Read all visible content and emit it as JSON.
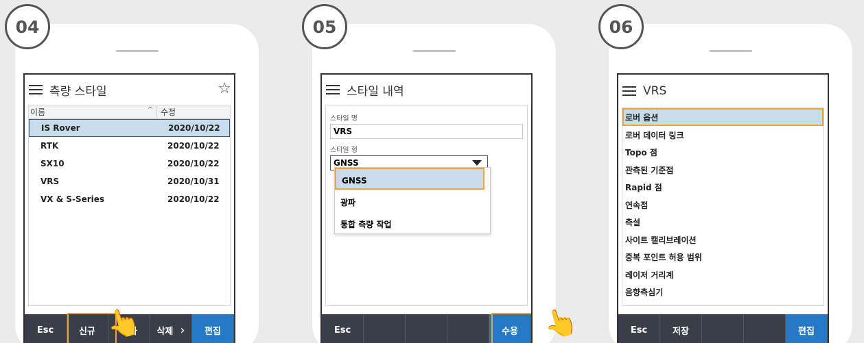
{
  "panels": [
    {
      "step": "04",
      "title": "측량 스타일",
      "columns": {
        "name": "이름",
        "sort": "^",
        "modified": "수정"
      },
      "rows": [
        {
          "name": "IS Rover",
          "date": "2020/10/22"
        },
        {
          "name": "RTK",
          "date": "2020/10/22"
        },
        {
          "name": "SX10",
          "date": "2020/10/22"
        },
        {
          "name": "VRS",
          "date": "2020/10/31"
        },
        {
          "name": "VX & S-Series",
          "date": "2020/10/22"
        }
      ],
      "buttons": [
        "Esc",
        "신규",
        "복사",
        "삭제",
        "편집"
      ],
      "more": "›"
    },
    {
      "step": "05",
      "title": "스타일 내역",
      "style_name_label": "스타일 명",
      "style_name_value": "VRS",
      "style_type_label": "스타일 형",
      "style_type_value": "GNSS",
      "options": [
        "GNSS",
        "광파",
        "통합 측량 작업"
      ],
      "buttons": [
        "Esc",
        "",
        "",
        "",
        "수용"
      ]
    },
    {
      "step": "06",
      "title": "VRS",
      "items": [
        "로버 옵션",
        "로버 데이터 링크",
        "Topo 점",
        "관측된 기준점",
        "Rapid 점",
        "연속점",
        "측설",
        "사이트 캘리브레이션",
        "중복 포인트 허용 범위",
        "레이저 거리계",
        "음향측심기"
      ],
      "buttons": [
        "Esc",
        "저장",
        "",
        "",
        "편집"
      ]
    }
  ],
  "colors": {
    "accent": "#f0a33b",
    "selection": "#c8dce9",
    "bar": "#3a3e48",
    "primary": "#2579c5"
  },
  "icons": {
    "menu": "hamburger-icon",
    "favorite": "star-icon",
    "dropdown": "triangle-down-icon",
    "pointer": "hand-pointer-icon"
  }
}
